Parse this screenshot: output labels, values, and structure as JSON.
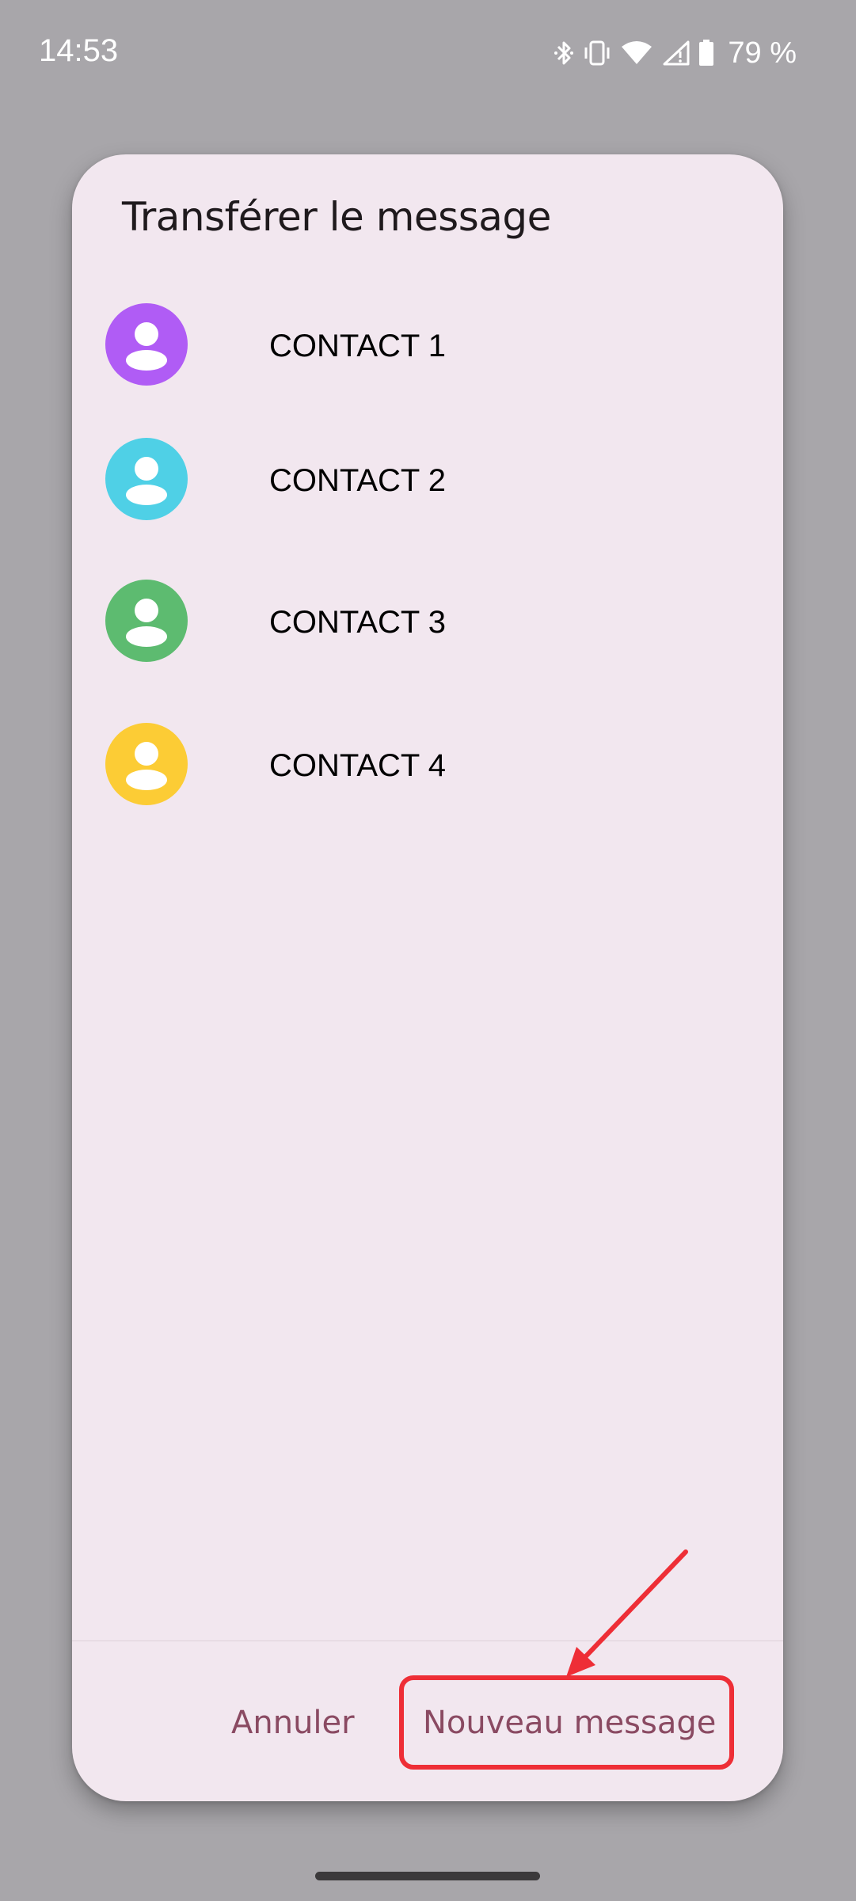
{
  "status_bar": {
    "time": "14:53",
    "battery_percent": "79 %",
    "icons": [
      "bluetooth-icon",
      "vibrate-icon",
      "wifi-icon",
      "signal-icon",
      "battery-icon"
    ]
  },
  "dialog": {
    "title": "Transférer le message",
    "contacts": [
      {
        "name": "CONTACT 1",
        "avatar_color": "#b05cf5"
      },
      {
        "name": "CONTACT 2",
        "avatar_color": "#4fd0e6"
      },
      {
        "name": "CONTACT 3",
        "avatar_color": "#5dbb70"
      },
      {
        "name": "CONTACT 4",
        "avatar_color": "#fccc35"
      }
    ],
    "cancel_label": "Annuler",
    "new_message_label": "Nouveau message"
  },
  "colors": {
    "scrim": "#a8a6aa",
    "dialog_bg": "#f2e7ef",
    "button_text": "#8a4a62",
    "annotation_red": "#ee2e36"
  }
}
